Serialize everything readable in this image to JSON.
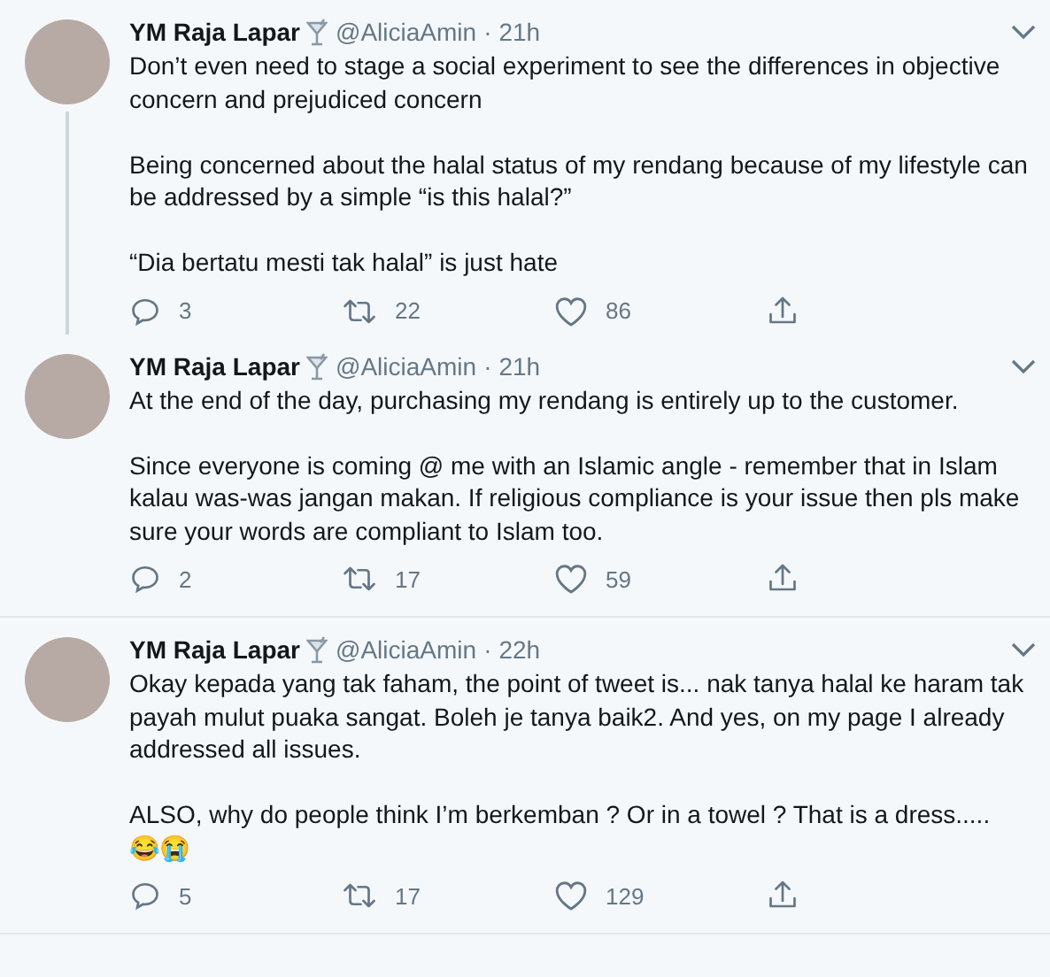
{
  "tweets": [
    {
      "name": "YM Raja Lapar",
      "handle": "@AliciaAmin",
      "separator": "·",
      "time": "21h",
      "thread_line": true,
      "paragraphs": [
        "Don’t even need to stage a social experiment to see the differences in objective concern and prejudiced concern",
        "Being concerned about the halal status of my rendang because of my lifestyle can be addressed by a simple “is this halal?”",
        "“Dia bertatu mesti tak halal” is just hate"
      ],
      "replies": "3",
      "retweets": "22",
      "likes": "86"
    },
    {
      "name": "YM Raja Lapar",
      "handle": "@AliciaAmin",
      "separator": "·",
      "time": "21h",
      "thread_line": false,
      "paragraphs": [
        "At the end of the day, purchasing my rendang is entirely up to the customer.",
        "Since everyone is coming @ me with an Islamic angle - remember that in Islam kalau was-was jangan makan. If religious compliance is your issue then pls make sure your words are compliant to Islam too."
      ],
      "replies": "2",
      "retweets": "17",
      "likes": "59"
    },
    {
      "name": "YM Raja Lapar",
      "handle": "@AliciaAmin",
      "separator": "·",
      "time": "22h",
      "thread_line": false,
      "paragraphs": [
        "Okay kepada yang tak faham, the point of tweet is... nak tanya halal ke haram tak payah mulut puaka sangat. Boleh je tanya baik2. And yes, on my page I already addressed all issues.",
        "ALSO, why do people think I’m berkemban ? Or in a towel ? That is a dress.....\n😂😭"
      ],
      "replies": "5",
      "retweets": "17",
      "likes": "129"
    }
  ]
}
